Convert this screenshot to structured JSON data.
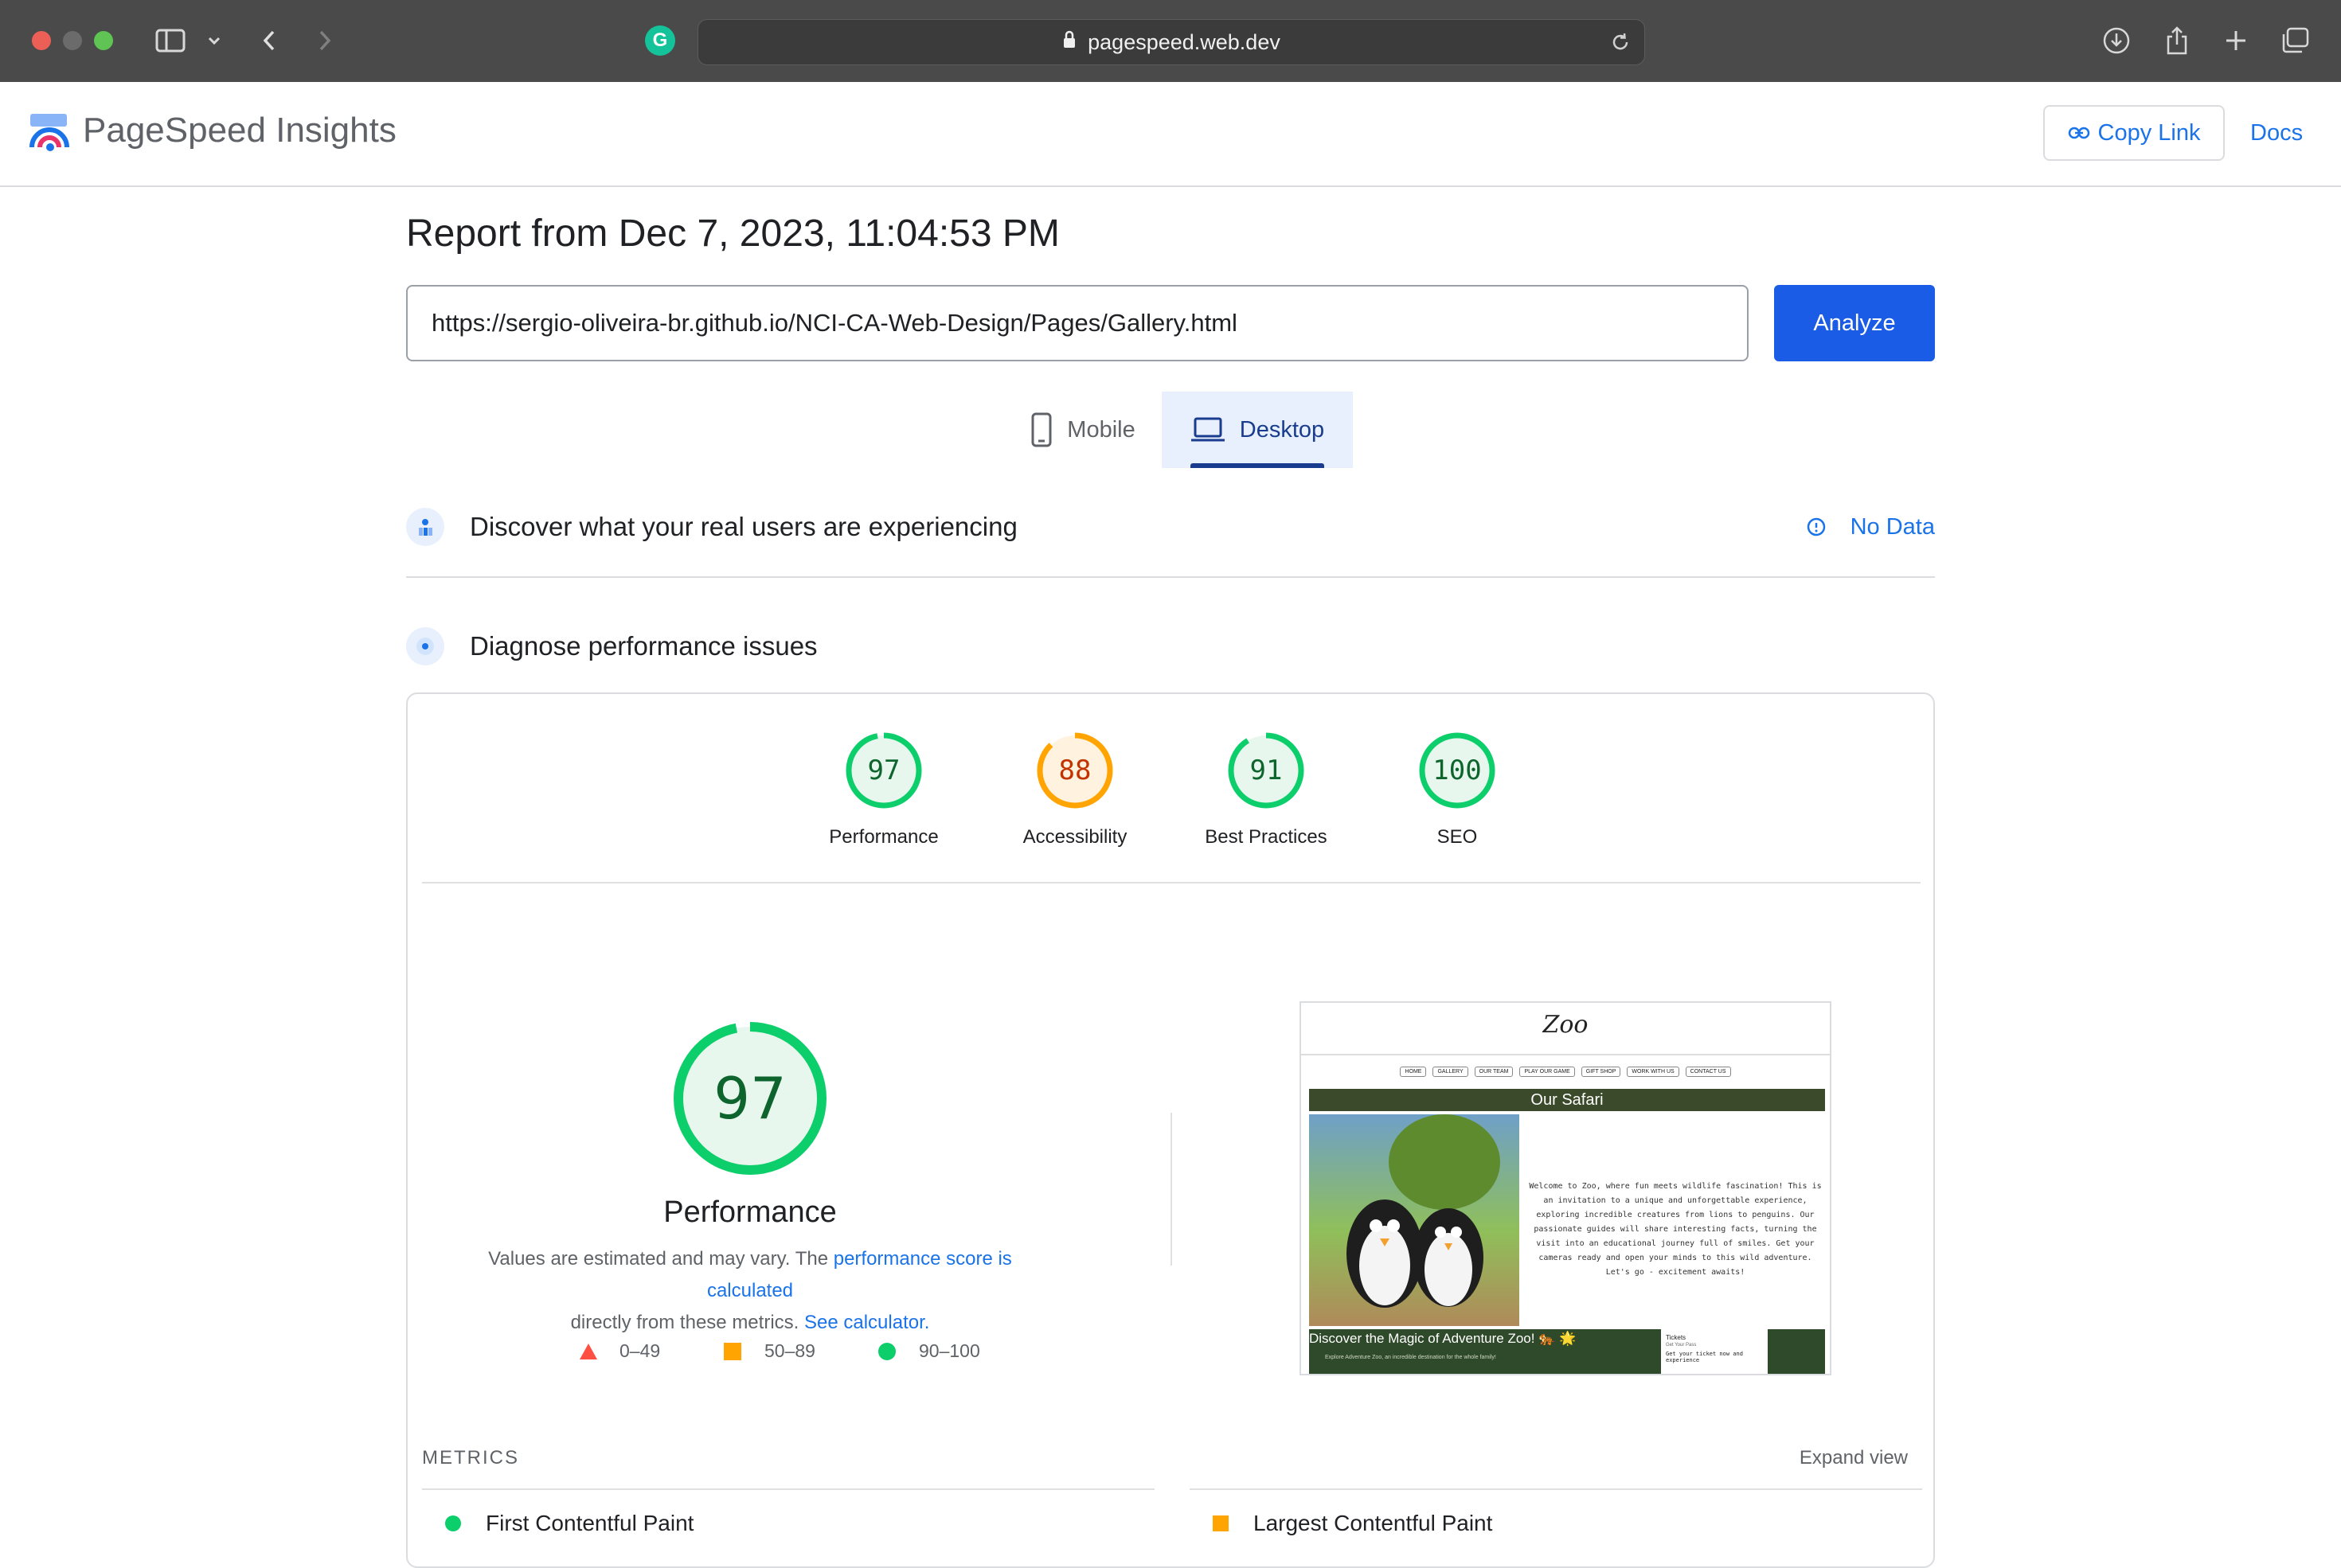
{
  "browser": {
    "url": "pagespeed.web.dev"
  },
  "header": {
    "brand": "PageSpeed Insights",
    "copy_link": "Copy Link",
    "docs": "Docs"
  },
  "report": {
    "title": "Report from Dec 7, 2023, 11:04:53 PM",
    "url_value": "https://sergio-oliveira-br.github.io/NCI-CA-Web-Design/Pages/Gallery.html",
    "analyze_label": "Analyze",
    "tabs": {
      "mobile": "Mobile",
      "desktop": "Desktop"
    },
    "section_real_users": "Discover what your real users are experiencing",
    "no_data": "No Data",
    "section_diagnose": "Diagnose performance issues"
  },
  "scores": [
    {
      "label": "Performance",
      "value": "97",
      "status": "good"
    },
    {
      "label": "Accessibility",
      "value": "88",
      "status": "average"
    },
    {
      "label": "Best Practices",
      "value": "91",
      "status": "good"
    },
    {
      "label": "SEO",
      "value": "100",
      "status": "good"
    }
  ],
  "performance": {
    "score": "97",
    "title": "Performance",
    "desc_prefix": "Values are estimated and may vary. The ",
    "desc_link1": "performance score is calculated",
    "desc_mid": "directly from these metrics. ",
    "desc_link2": "See calculator."
  },
  "legend": {
    "fail": "0–49",
    "average": "50–89",
    "pass": "90–100"
  },
  "screenshot": {
    "logo": "Zoo",
    "nav": [
      "HOME",
      "GALLERY",
      "OUR TEAM",
      "PLAY OUR GAME",
      "GIFT SHOP",
      "WORK WITH US",
      "CONTACT US"
    ],
    "banner": "Our Safari",
    "body_text": "Welcome to Zoo, where fun meets wildlife fascination! This is an invitation to a unique and unforgettable experience, exploring incredible creatures from lions to penguins. Our passionate guides will share interesting facts, turning the visit into an educational journey full of smiles. Get your cameras ready and open your minds to this wild adventure. Let's go - excitement awaits!",
    "footer_title": "Discover the Magic of Adventure Zoo! 🐅 🌟",
    "footer_sub": "Explore Adventure Zoo, an incredible destination for the whole family!",
    "tickets_title": "Tickets",
    "tickets_sub": "Get Your Pass",
    "tickets_body": "Get your ticket now and experience"
  },
  "metrics": {
    "heading": "METRICS",
    "expand": "Expand view",
    "items": [
      "First Contentful Paint",
      "Largest Contentful Paint"
    ]
  },
  "colors": {
    "good": "#0cce6b",
    "average": "#ffa400",
    "fail": "#ff4e42",
    "accent": "#1a73e8"
  }
}
